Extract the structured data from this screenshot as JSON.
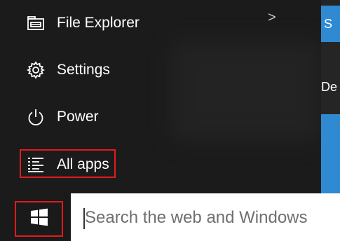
{
  "start_menu": {
    "items": [
      {
        "label": "File Explorer",
        "icon": "file-explorer-icon",
        "has_submenu": true
      },
      {
        "label": "Settings",
        "icon": "gear-icon"
      },
      {
        "label": "Power",
        "icon": "power-icon"
      },
      {
        "label": "All apps",
        "icon": "all-apps-list-icon",
        "highlighted": true
      }
    ],
    "submenu_chevron": ">"
  },
  "tiles": {
    "top_tile_text": "S",
    "group_label": "De",
    "tile_color": "#2f8ad1"
  },
  "taskbar": {
    "start_icon": "windows-logo-icon",
    "search_placeholder": "Search the web and Windows"
  },
  "colors": {
    "menu_bg": "#1b1b1b",
    "highlight_border": "#e11b1b",
    "accent": "#2f8ad1"
  }
}
